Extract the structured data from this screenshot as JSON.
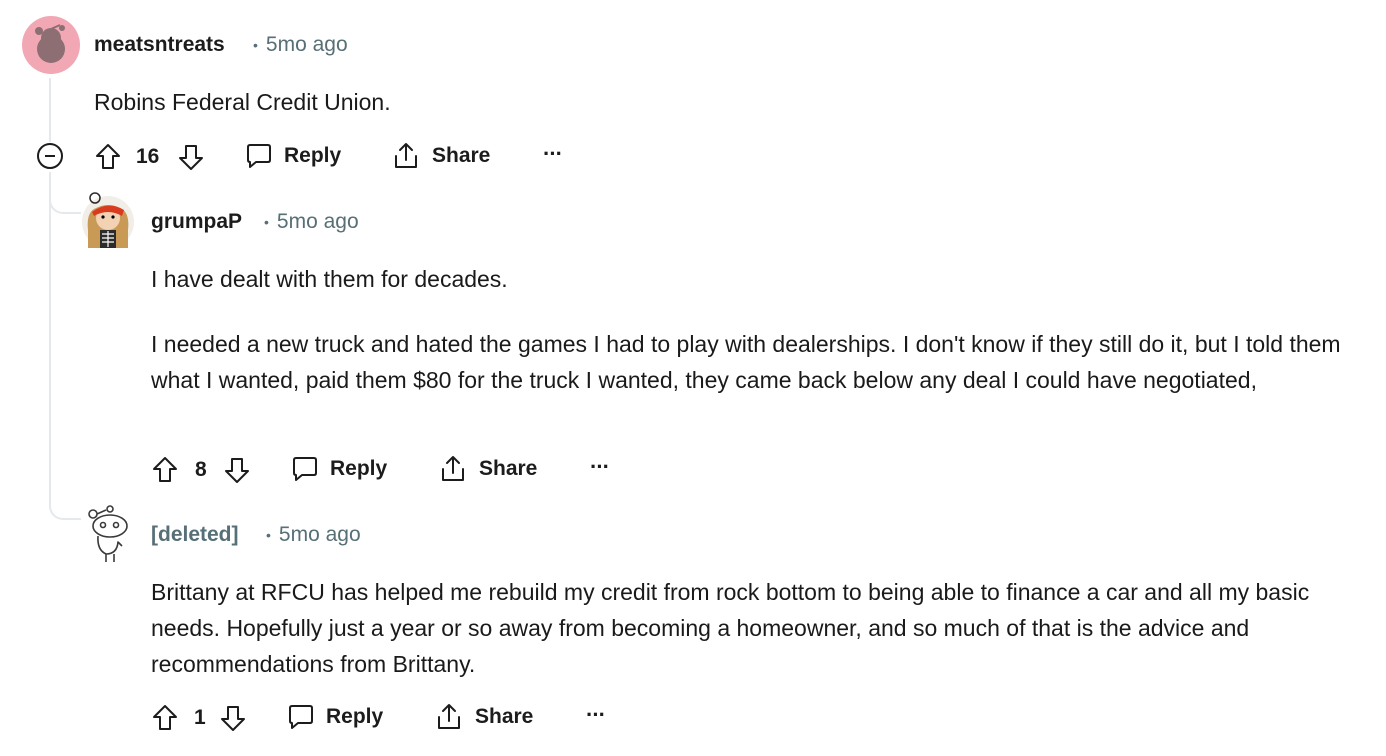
{
  "comments": [
    {
      "username": "meatsntreats",
      "time": "5mo ago",
      "paragraphs": [
        "Robins Federal Credit Union."
      ],
      "score": "16",
      "reply_label": "Reply",
      "share_label": "Share",
      "more_label": "···"
    },
    {
      "username": "grumpaP",
      "time": "5mo ago",
      "paragraphs": [
        "I have dealt with them for decades.",
        "I needed a new truck and hated the games I had to play with dealerships. I don't know if they still do it, but I told them what I wanted, paid them $80 for the truck I wanted, they came back below any deal I could have negotiated,"
      ],
      "score": "8",
      "reply_label": "Reply",
      "share_label": "Share",
      "more_label": "···"
    },
    {
      "username": "[deleted]",
      "time": "5mo ago",
      "paragraphs": [
        "Brittany at RFCU has helped me rebuild my credit from rock bottom to being able to finance a car and all my basic needs. Hopefully just a year or so away from becoming a homeowner, and so much of that is the advice and recommendations from Brittany."
      ],
      "score": "1",
      "reply_label": "Reply",
      "share_label": "Share",
      "more_label": "···"
    }
  ],
  "dot_separator": "•",
  "icons": {
    "upvote": "upvote-icon",
    "downvote": "downvote-icon",
    "reply": "chat-bubble-icon",
    "share": "share-icon",
    "collapse": "collapse-minus-icon"
  }
}
